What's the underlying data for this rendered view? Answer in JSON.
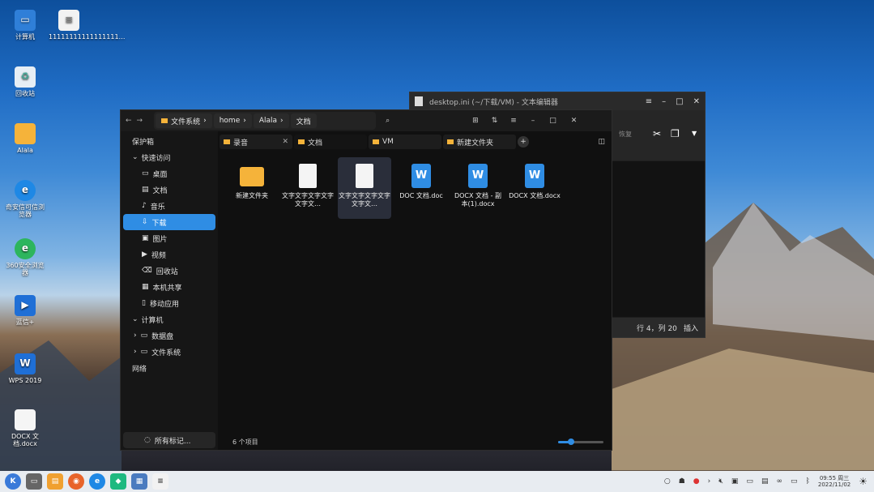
{
  "desktop": {
    "icons": [
      {
        "label": "计算机"
      },
      {
        "label": "11111111111111111…"
      },
      {
        "label": "回收站"
      },
      {
        "label": "Alala"
      },
      {
        "label": "奇安信可信浏览器"
      },
      {
        "label": "360安全浏览器"
      },
      {
        "label": "蓝信+"
      },
      {
        "label": "WPS 2019"
      },
      {
        "label": "DOCX 文档.docx"
      }
    ]
  },
  "editor": {
    "title": "desktop.ini (~/下载/VM) - 文本编辑器",
    "toolbar_hint": "恢复",
    "status_position": "行 4，列 20",
    "status_mode": "插入"
  },
  "fm": {
    "breadcrumbs": [
      "文件系统",
      "home",
      "Alala",
      "文档"
    ],
    "tabs": [
      {
        "label": "录音"
      },
      {
        "label": "文档"
      },
      {
        "label": "VM"
      },
      {
        "label": "新建文件夹"
      }
    ],
    "sidebar": {
      "vault": "保护箱",
      "quick_access": "快速访问",
      "quick_items": [
        "桌面",
        "文档",
        "音乐",
        "下载",
        "图片",
        "视频",
        "回收站",
        "本机共享",
        "移动应用"
      ],
      "computer": "计算机",
      "computer_items": [
        "数据盘",
        "文件系统"
      ],
      "network": "网络",
      "all_tags": "所有标记..."
    },
    "files": [
      {
        "name": "新建文件夹",
        "type": "folder"
      },
      {
        "name": "文字文字文字文字文字文…",
        "type": "doc"
      },
      {
        "name": "文字文字文字文字文字文…",
        "type": "doc"
      },
      {
        "name": "DOC 文档.doc",
        "type": "wps"
      },
      {
        "name": "DOCX 文档 - 副本(1).docx",
        "type": "wps"
      },
      {
        "name": "DOCX 文档.docx",
        "type": "wps"
      }
    ],
    "status": "6 个项目"
  },
  "taskbar": {
    "time": "09:55 周三",
    "date": "2022/11/02"
  }
}
